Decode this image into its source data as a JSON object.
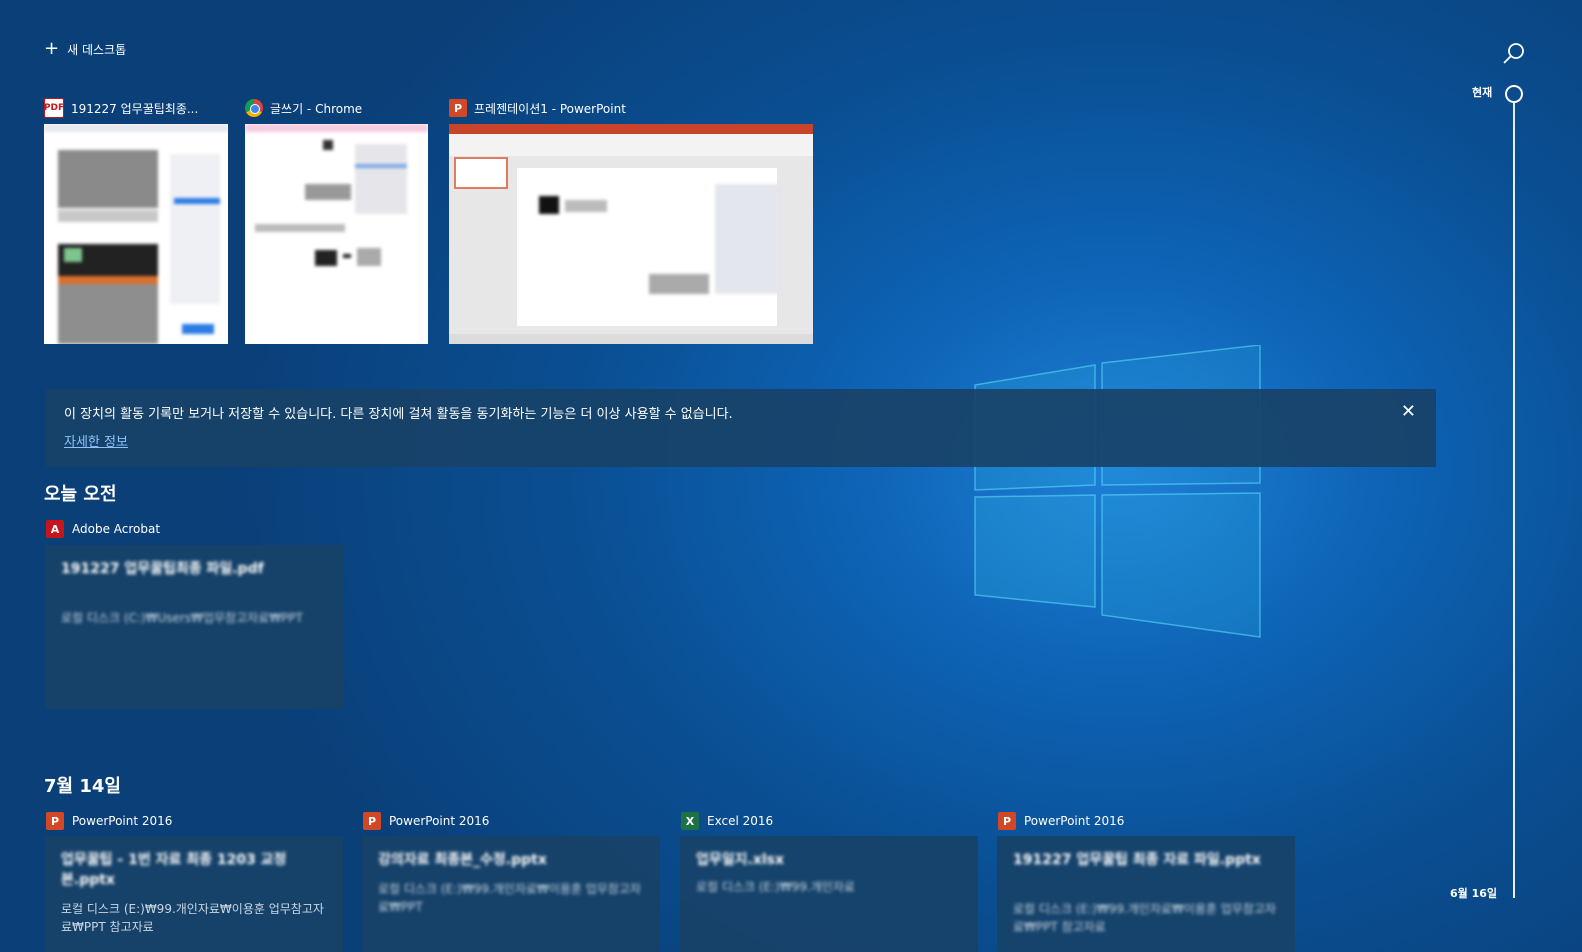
{
  "header": {
    "new_desktop_label": "새 데스크톱"
  },
  "timeline": {
    "now_label": "현재",
    "bottom_date": "6월 16일"
  },
  "windows": [
    {
      "title": "191227 업무꿀팁최종...",
      "icon": "pdf-icon"
    },
    {
      "title": "글쓰기 - Chrome",
      "icon": "chrome-icon"
    },
    {
      "title": "프레젠테이션1 - PowerPoint",
      "icon": "powerpoint-icon"
    }
  ],
  "notice": {
    "message": "이 장치의 활동 기록만 보거나 저장할 수 있습니다. 다른 장치에 걸쳐 활동을 동기화하는 기능은 더 이상 사용할 수 없습니다.",
    "link": "자세한 정보"
  },
  "sections": [
    {
      "heading": "오늘 오전",
      "items": [
        {
          "app": "Adobe Acrobat",
          "icon": "acrobat-icon",
          "title": "191227 업무꿀팁최종 파일.pdf",
          "subtitle": "로컬 디스크 (C:)₩Users₩업무참고자료₩PPT"
        }
      ]
    },
    {
      "heading": "7월 14일",
      "items": [
        {
          "app": "PowerPoint 2016",
          "icon": "powerpoint-icon",
          "title": "업무꿀팁 - 1번 자료 최종 1203 교정본.pptx",
          "subtitle": "로컬 디스크 (E:)₩99.개인자료₩이용훈 업무참고자료₩PPT 참고자료"
        },
        {
          "app": "PowerPoint 2016",
          "icon": "powerpoint-icon",
          "title": "강의자료 최종본_수정.pptx",
          "subtitle": "로컬 디스크 (E:)₩99.개인자료₩이용훈 업무참고자료₩PPT"
        },
        {
          "app": "Excel 2016",
          "icon": "excel-icon",
          "title": "업무일지.xlsx",
          "subtitle": "로컬 디스크 (E:)₩99.개인자료"
        },
        {
          "app": "PowerPoint 2016",
          "icon": "powerpoint-icon",
          "title": "191227 업무꿀팁 최종 자료 파일.pptx",
          "subtitle": "로컬 디스크 (E:)₩99.개인자료₩이용훈 업무참고자료₩PPT 참고자료"
        }
      ]
    }
  ],
  "colors": {
    "background": "#0d63b5",
    "card": "#184268",
    "link": "#8fc1ff"
  }
}
